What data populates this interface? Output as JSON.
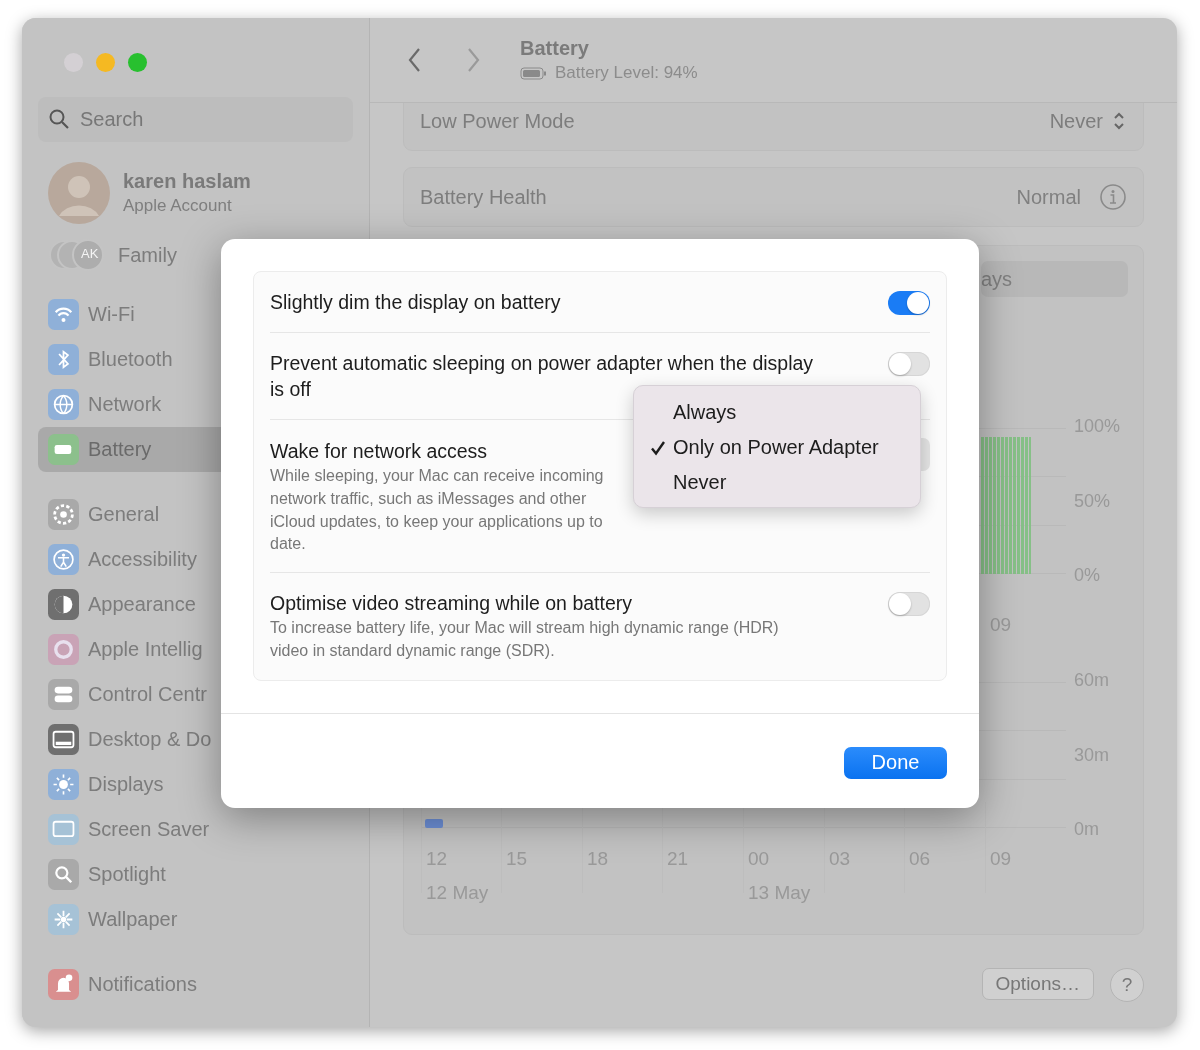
{
  "sidebar": {
    "search": {
      "placeholder": "Search"
    },
    "account": {
      "name": "karen haslam",
      "subtitle": "Apple Account"
    },
    "family": {
      "label": "Family",
      "badge": "AK"
    },
    "groups": [
      [
        {
          "label": "Wi-Fi",
          "kind": "wifi",
          "selected": false
        },
        {
          "label": "Bluetooth",
          "kind": "bluetooth",
          "selected": false
        },
        {
          "label": "Network",
          "kind": "network",
          "selected": false
        },
        {
          "label": "Battery",
          "kind": "battery",
          "selected": true
        }
      ],
      [
        {
          "label": "General",
          "kind": "general",
          "selected": false
        },
        {
          "label": "Accessibility",
          "kind": "accessibility",
          "selected": false
        },
        {
          "label": "Appearance",
          "kind": "appearance",
          "selected": false
        },
        {
          "label": "Apple Intellig",
          "kind": "intelligence",
          "selected": false
        },
        {
          "label": "Control Centr",
          "kind": "control",
          "selected": false
        },
        {
          "label": "Desktop & Do",
          "kind": "desktop",
          "selected": false
        },
        {
          "label": "Displays",
          "kind": "displays",
          "selected": false
        },
        {
          "label": "Screen Saver",
          "kind": "screensaver",
          "selected": false
        },
        {
          "label": "Spotlight",
          "kind": "spotlight",
          "selected": false
        },
        {
          "label": "Wallpaper",
          "kind": "wallpaper",
          "selected": false
        }
      ],
      [
        {
          "label": "Notifications",
          "kind": "notifications",
          "selected": false
        }
      ]
    ]
  },
  "header": {
    "title": "Battery",
    "subtitle": "Battery Level: 94%"
  },
  "settings": [
    {
      "label": "Low Power Mode",
      "value": "Never",
      "kind": "popup"
    },
    {
      "label": "Battery Health",
      "value": "Normal",
      "kind": "info"
    }
  ],
  "history": {
    "segment": "ays",
    "level_axis": [
      "100%",
      "50%",
      "0%"
    ],
    "level_x_label": "09",
    "usage_axis": [
      "60m",
      "30m",
      "0m"
    ],
    "x_labels": [
      "12",
      "15",
      "18",
      "21",
      "00",
      "03",
      "06",
      "09"
    ],
    "dates": [
      "12 May",
      "13 May"
    ]
  },
  "footer": {
    "options": "Options…",
    "help": "?"
  },
  "dialog": {
    "rows": [
      {
        "kind": "toggle",
        "title": "Slightly dim the display on battery",
        "on": true
      },
      {
        "kind": "toggle",
        "title": "Prevent automatic sleeping on power adapter when the display is off",
        "on": false
      },
      {
        "kind": "popup",
        "title": "Wake for network access",
        "description": "While sleeping, your Mac can receive incoming network traffic, such as iMessages and other iCloud updates, to keep your applications up to date."
      },
      {
        "kind": "toggle",
        "title": "Optimise video streaming while on battery",
        "description": "To increase battery life, your Mac will stream high dynamic range (HDR) video in standard dynamic range (SDR).",
        "on": false
      }
    ],
    "menu": [
      {
        "label": "Always",
        "selected": false
      },
      {
        "label": "Only on Power Adapter",
        "selected": true
      },
      {
        "label": "Never",
        "selected": false
      }
    ],
    "done": "Done"
  }
}
